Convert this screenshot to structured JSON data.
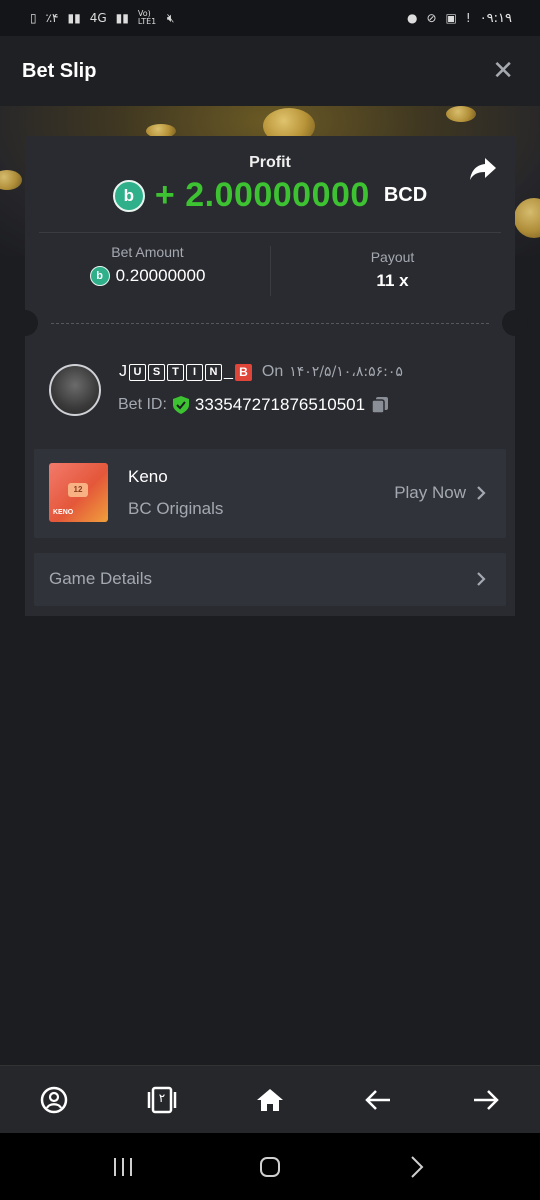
{
  "status_bar": {
    "battery_text": "٪۴",
    "network": "4G",
    "volte": "Vo) LTE1",
    "time": "۰۹:۱۹"
  },
  "header": {
    "title": "Bet Slip"
  },
  "profit": {
    "label": "Profit",
    "sign": "+",
    "value": "2.00000000",
    "currency": "BCD",
    "coin_color": "#2fb08a",
    "value_color": "#3dc232"
  },
  "bet_amount": {
    "label": "Bet Amount",
    "value": "0.20000000"
  },
  "payout": {
    "label": "Payout",
    "value": "11 x"
  },
  "user": {
    "name_letters": [
      "J",
      "U",
      "S",
      "T",
      "I",
      "N",
      "_",
      "B"
    ],
    "on_label": "On",
    "date": "۱۴۰۲/۵/۱۰،۸:۵۶:۰۵",
    "bet_id_label": "Bet ID:",
    "bet_id": "333547271876510501"
  },
  "game": {
    "name": "Keno",
    "provider": "BC Originals",
    "play_label": "Play Now",
    "thumb_number": "12",
    "thumb_label": "KENO"
  },
  "details": {
    "label": "Game Details"
  },
  "bottom_nav": {
    "items": [
      "account-icon",
      "tabs-icon",
      "home-icon",
      "back-arrow-icon",
      "forward-arrow-icon"
    ],
    "tabs_count": "۲"
  }
}
